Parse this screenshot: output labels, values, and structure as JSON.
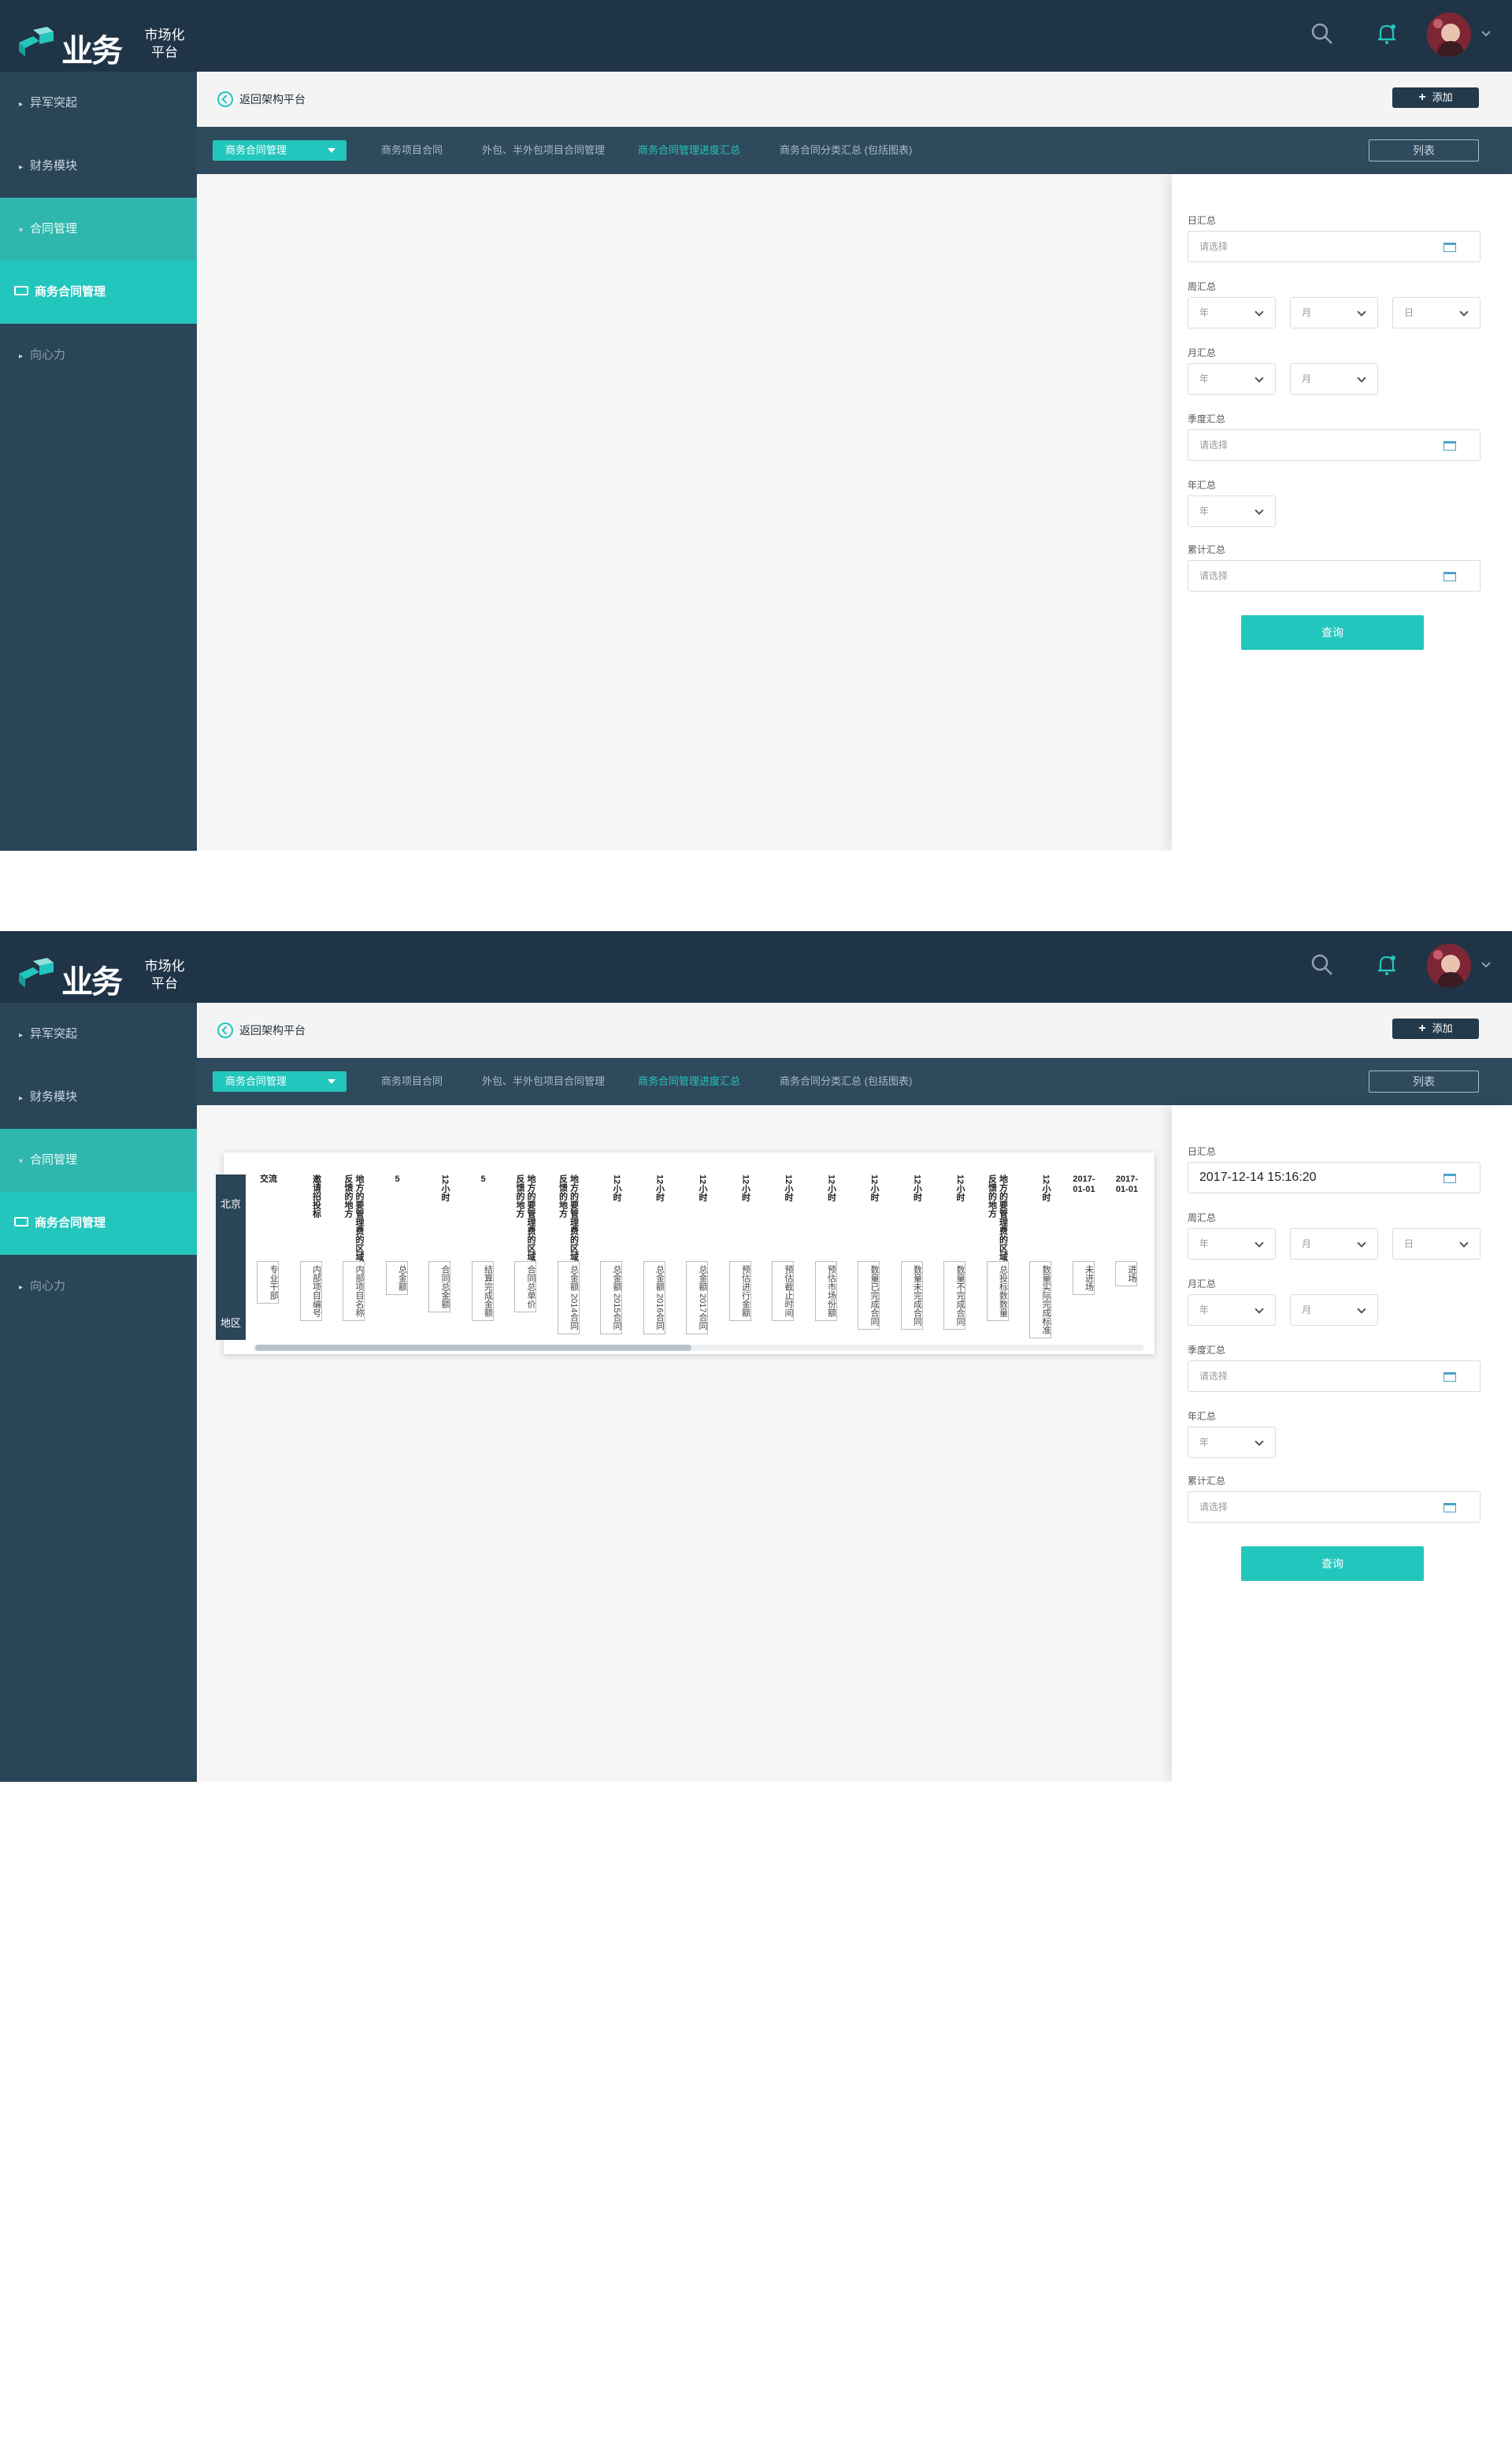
{
  "header": {
    "logo_main": "业务",
    "logo_sub_line1": "市场化",
    "logo_sub_line2": "平台"
  },
  "sidebar": {
    "items": [
      {
        "label": "异军突起"
      },
      {
        "label": "财务模块"
      },
      {
        "label": "合同管理"
      },
      {
        "label": "商务合同管理"
      },
      {
        "label": "向心力"
      }
    ]
  },
  "subheader": {
    "back_label": "返回架构平台",
    "add_label": "添加"
  },
  "tabbar": {
    "dropdown_label": "商务合同管理",
    "tabs": [
      {
        "label": "商务项目合同"
      },
      {
        "label": "外包、半外包项目合同管理"
      },
      {
        "label": "商务合同管理进度汇总"
      },
      {
        "label": "商务合同分类汇总 (包括图表)"
      }
    ],
    "list_label": "列表"
  },
  "filters": {
    "day_label": "日汇总",
    "day_placeholder": "请选择",
    "day_value_filled": "2017-12-14 15:16:20",
    "week_label": "周汇总",
    "month_label": "月汇总",
    "quarter_label": "季度汇总",
    "quarter_placeholder": "请选择",
    "year_label": "年汇总",
    "cumulative_label": "累计汇总",
    "cumulative_placeholder": "请选择",
    "year_opt": "年",
    "month_opt": "月",
    "day_opt": "日",
    "query_label": "查询"
  },
  "table": {
    "row_region": "北京",
    "row_footer": "地区",
    "columns": [
      {
        "head": "交流",
        "cell": "专业干部"
      },
      {
        "head": "邀请招投标",
        "cell": "内部项目编号"
      },
      {
        "head": "地方的要管理费的区域反馈的地方",
        "cell": "内部项目名称"
      },
      {
        "head": "5",
        "cell": "总金额"
      },
      {
        "head": "12小时",
        "cell": "合同总金额"
      },
      {
        "head": "5",
        "cell": "结算完成金额"
      },
      {
        "head": "地方的要管理费的区域反馈的地方",
        "cell": "合同总单价"
      },
      {
        "head": "地方的要管理费的区域反馈的地方",
        "cell": "总金额 2014合同"
      },
      {
        "head": "12小时",
        "cell": "总金额 2015合同"
      },
      {
        "head": "12小时",
        "cell": "总金额 2016合同"
      },
      {
        "head": "12小时",
        "cell": "总金额 2017合同"
      },
      {
        "head": "12小时",
        "cell": "预估进行金额"
      },
      {
        "head": "12小时",
        "cell": "预估截止时间"
      },
      {
        "head": "12小时",
        "cell": "预估市场份额"
      },
      {
        "head": "12小时",
        "cell": "数量已完成合同"
      },
      {
        "head": "12小时",
        "cell": "数量未完成合同"
      },
      {
        "head": "12小时",
        "cell": "数量不完成合同"
      },
      {
        "head": "地方的要管理费的区域反馈的地方",
        "cell": "总投标数数量"
      },
      {
        "head": "12小时",
        "cell": "数量实际完成标准"
      },
      {
        "head": "2017-01-01",
        "cell": "未进场"
      },
      {
        "head": "2017-01-01",
        "cell": "进场"
      }
    ]
  },
  "colors": {
    "topbar": "#203447",
    "sidebar": "#2b4558",
    "accent": "#23c6bd",
    "tabbar": "#2f4a5c"
  },
  "icons": [
    "search-icon",
    "bell-icon",
    "avatar",
    "calendar-icon",
    "chevron-down-icon",
    "back-circle-icon",
    "plus-icon"
  ]
}
